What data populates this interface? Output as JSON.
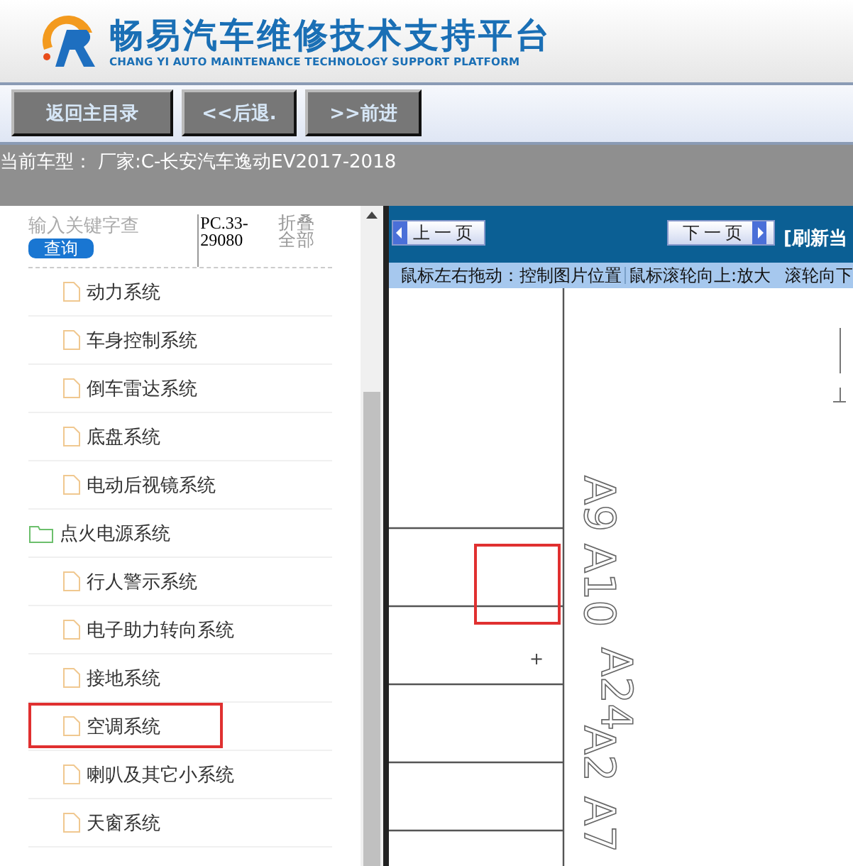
{
  "header": {
    "title": "畅易汽车维修技术支持平台",
    "subtitle": "CHANG YI AUTO MAINTENANCE TECHNOLOGY SUPPORT PLATFORM"
  },
  "nav": {
    "buttons": [
      "返回主目录",
      "<<后退.",
      ">>前进"
    ]
  },
  "vehicle": {
    "label": "当前车型：",
    "value": "厂家:C-长安汽车逸动EV2017-2018"
  },
  "sidebar": {
    "search": {
      "placeholder": "输入关键字查",
      "button": "查询"
    },
    "code": "PC.33-29080",
    "collapse_all": "折叠全部",
    "tree": [
      {
        "kind": "continuation",
        "children": [
          {
            "kind": "file",
            "label": "动力系统",
            "marked": false
          },
          {
            "kind": "file",
            "label": "车身控制系统",
            "marked": false
          },
          {
            "kind": "file",
            "label": "倒车雷达系统",
            "marked": false
          },
          {
            "kind": "file",
            "label": "底盘系统",
            "marked": false
          },
          {
            "kind": "file",
            "label": "电动后视镜系统",
            "marked": false
          }
        ]
      },
      {
        "kind": "folder",
        "label": "点火电源系统",
        "marked": false,
        "children": [
          {
            "kind": "file",
            "label": "行人警示系统",
            "marked": false
          },
          {
            "kind": "file",
            "label": "电子助力转向系统",
            "marked": false
          },
          {
            "kind": "file",
            "label": "接地系统",
            "marked": false
          },
          {
            "kind": "file",
            "label": "空调系统",
            "marked": true
          },
          {
            "kind": "file",
            "label": "喇叭及其它小系统",
            "marked": false
          },
          {
            "kind": "file",
            "label": "天窗系统",
            "marked": false
          }
        ]
      }
    ]
  },
  "viewer": {
    "prev_button": "上一页",
    "next_button": "下一页",
    "refresh_link": "[刷新当",
    "hint_drag": "鼠标左右拖动：控制图片位置",
    "hint_zoom": "鼠标滚轮向上:放大",
    "hint_zoom_out": "滚轮向下",
    "diagram": {
      "pin_labels": [
        "A9",
        "A10",
        "A24",
        "A2",
        "A7"
      ],
      "mark": "+"
    }
  }
}
